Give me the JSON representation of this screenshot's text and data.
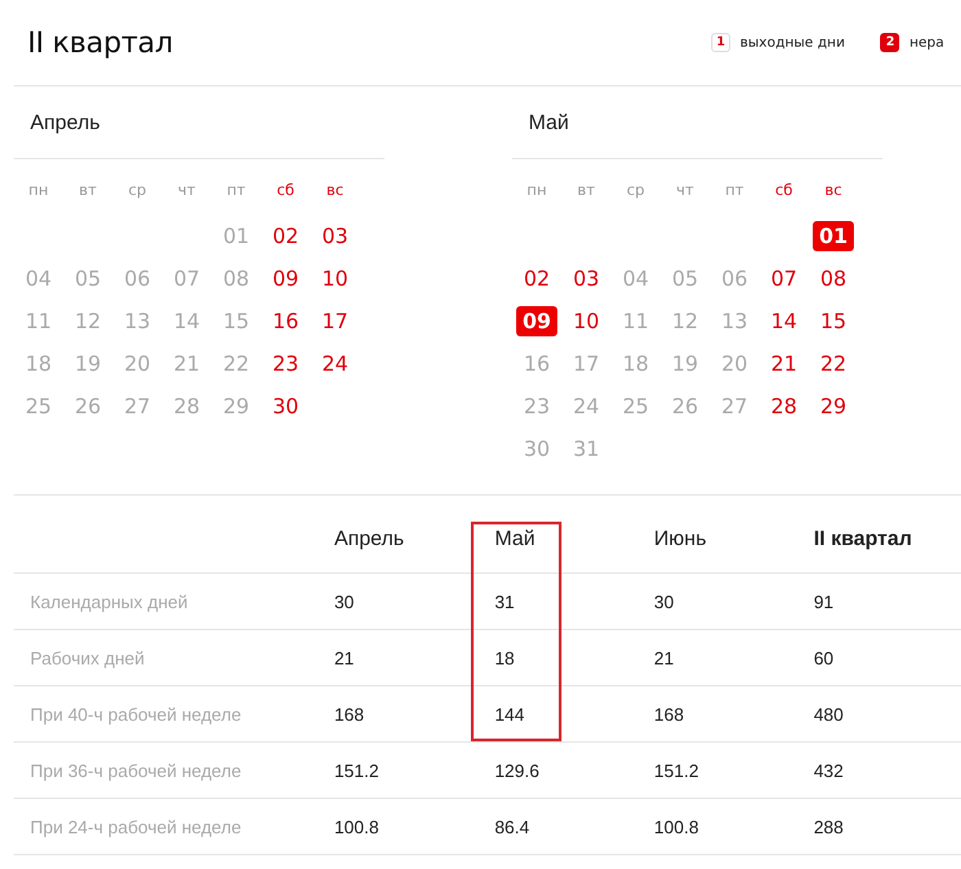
{
  "title": "II квартал",
  "legend": [
    {
      "badge": "1",
      "label": "выходные дни",
      "kind": "weekend"
    },
    {
      "badge": "2",
      "label": "нера",
      "kind": "holiday"
    }
  ],
  "months": [
    {
      "name": "Апрель",
      "weekdays": [
        {
          "label": "пн",
          "weekend": false
        },
        {
          "label": "вт",
          "weekend": false
        },
        {
          "label": "ср",
          "weekend": false
        },
        {
          "label": "чт",
          "weekend": false
        },
        {
          "label": "пт",
          "weekend": false
        },
        {
          "label": "сб",
          "weekend": true
        },
        {
          "label": "вс",
          "weekend": true
        }
      ],
      "weeks": [
        [
          {
            "kind": "empty"
          },
          {
            "kind": "empty"
          },
          {
            "kind": "empty"
          },
          {
            "kind": "empty"
          },
          {
            "day": "01",
            "kind": "work"
          },
          {
            "day": "02",
            "kind": "weekend"
          },
          {
            "day": "03",
            "kind": "weekend"
          }
        ],
        [
          {
            "day": "04",
            "kind": "work"
          },
          {
            "day": "05",
            "kind": "work"
          },
          {
            "day": "06",
            "kind": "work"
          },
          {
            "day": "07",
            "kind": "work"
          },
          {
            "day": "08",
            "kind": "work"
          },
          {
            "day": "09",
            "kind": "weekend"
          },
          {
            "day": "10",
            "kind": "weekend"
          }
        ],
        [
          {
            "day": "11",
            "kind": "work"
          },
          {
            "day": "12",
            "kind": "work"
          },
          {
            "day": "13",
            "kind": "work"
          },
          {
            "day": "14",
            "kind": "work"
          },
          {
            "day": "15",
            "kind": "work"
          },
          {
            "day": "16",
            "kind": "weekend"
          },
          {
            "day": "17",
            "kind": "weekend"
          }
        ],
        [
          {
            "day": "18",
            "kind": "work"
          },
          {
            "day": "19",
            "kind": "work"
          },
          {
            "day": "20",
            "kind": "work"
          },
          {
            "day": "21",
            "kind": "work"
          },
          {
            "day": "22",
            "kind": "work"
          },
          {
            "day": "23",
            "kind": "weekend"
          },
          {
            "day": "24",
            "kind": "weekend"
          }
        ],
        [
          {
            "day": "25",
            "kind": "work"
          },
          {
            "day": "26",
            "kind": "work"
          },
          {
            "day": "27",
            "kind": "work"
          },
          {
            "day": "28",
            "kind": "work"
          },
          {
            "day": "29",
            "kind": "work"
          },
          {
            "day": "30",
            "kind": "weekend"
          },
          {
            "kind": "empty"
          }
        ]
      ]
    },
    {
      "name": "Май",
      "weekdays": [
        {
          "label": "пн",
          "weekend": false
        },
        {
          "label": "вт",
          "weekend": false
        },
        {
          "label": "ср",
          "weekend": false
        },
        {
          "label": "чт",
          "weekend": false
        },
        {
          "label": "пт",
          "weekend": false
        },
        {
          "label": "сб",
          "weekend": true
        },
        {
          "label": "вс",
          "weekend": true
        }
      ],
      "weeks": [
        [
          {
            "kind": "empty"
          },
          {
            "kind": "empty"
          },
          {
            "kind": "empty"
          },
          {
            "kind": "empty"
          },
          {
            "kind": "empty"
          },
          {
            "kind": "empty"
          },
          {
            "day": "01",
            "kind": "holiday"
          }
        ],
        [
          {
            "day": "02",
            "kind": "weekend"
          },
          {
            "day": "03",
            "kind": "weekend"
          },
          {
            "day": "04",
            "kind": "work"
          },
          {
            "day": "05",
            "kind": "work"
          },
          {
            "day": "06",
            "kind": "work"
          },
          {
            "day": "07",
            "kind": "weekend"
          },
          {
            "day": "08",
            "kind": "weekend"
          }
        ],
        [
          {
            "day": "09",
            "kind": "holiday"
          },
          {
            "day": "10",
            "kind": "weekend"
          },
          {
            "day": "11",
            "kind": "work"
          },
          {
            "day": "12",
            "kind": "work"
          },
          {
            "day": "13",
            "kind": "work"
          },
          {
            "day": "14",
            "kind": "weekend"
          },
          {
            "day": "15",
            "kind": "weekend"
          }
        ],
        [
          {
            "day": "16",
            "kind": "work"
          },
          {
            "day": "17",
            "kind": "work"
          },
          {
            "day": "18",
            "kind": "work"
          },
          {
            "day": "19",
            "kind": "work"
          },
          {
            "day": "20",
            "kind": "work"
          },
          {
            "day": "21",
            "kind": "weekend"
          },
          {
            "day": "22",
            "kind": "weekend"
          }
        ],
        [
          {
            "day": "23",
            "kind": "work"
          },
          {
            "day": "24",
            "kind": "work"
          },
          {
            "day": "25",
            "kind": "work"
          },
          {
            "day": "26",
            "kind": "work"
          },
          {
            "day": "27",
            "kind": "work"
          },
          {
            "day": "28",
            "kind": "weekend"
          },
          {
            "day": "29",
            "kind": "weekend"
          }
        ],
        [
          {
            "day": "30",
            "kind": "work"
          },
          {
            "day": "31",
            "kind": "work"
          },
          {
            "kind": "empty"
          },
          {
            "kind": "empty"
          },
          {
            "kind": "empty"
          },
          {
            "kind": "empty"
          },
          {
            "kind": "empty"
          }
        ]
      ]
    }
  ],
  "table": {
    "columns": [
      {
        "label": "Апрель",
        "bold": false,
        "selected": false
      },
      {
        "label": "Май",
        "bold": false,
        "selected": true
      },
      {
        "label": "Июнь",
        "bold": false,
        "selected": false
      },
      {
        "label": "II квартал",
        "bold": true,
        "selected": false
      }
    ],
    "rows": [
      {
        "label": "Календарных дней",
        "values": [
          "30",
          "31",
          "30",
          "91"
        ]
      },
      {
        "label": "Рабочих дней",
        "values": [
          "21",
          "18",
          "21",
          "60"
        ]
      },
      {
        "label": "При 40-ч рабочей неделе",
        "values": [
          "168",
          "144",
          "168",
          "480"
        ]
      },
      {
        "label": "При 36-ч рабочей неделе",
        "values": [
          "151.2",
          "129.6",
          "151.2",
          "432"
        ]
      },
      {
        "label": "При 24-ч рабочей неделе",
        "values": [
          "100.8",
          "86.4",
          "100.8",
          "288"
        ]
      }
    ]
  }
}
